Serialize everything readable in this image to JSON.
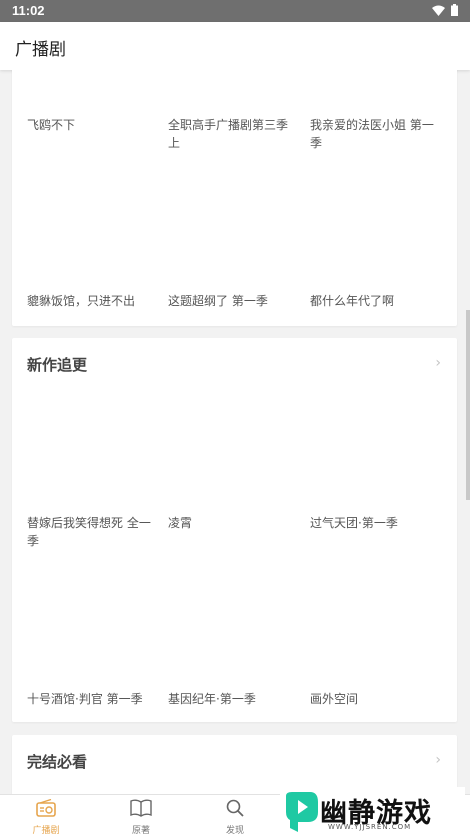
{
  "status_bar": {
    "time": "11:02"
  },
  "app_bar": {
    "title": "广播剧"
  },
  "section_top": {
    "row1": [
      {
        "title": "飞鸥不下"
      },
      {
        "title": "全职高手广播剧第三季上"
      },
      {
        "title": "我亲爱的法医小姐 第一季"
      }
    ],
    "row2": [
      {
        "title": "貔貅饭馆，只进不出"
      },
      {
        "title": "这题超纲了 第一季"
      },
      {
        "title": "都什么年代了啊"
      }
    ]
  },
  "section_new": {
    "title": "新作追更",
    "chevron": "›",
    "row1": [
      {
        "title": "替嫁后我笑得想死 全一季"
      },
      {
        "title": "凌霄"
      },
      {
        "title": "过气天团·第一季"
      }
    ],
    "row2": [
      {
        "title": "十号酒馆·判官 第一季"
      },
      {
        "title": "基因纪年·第一季"
      },
      {
        "title": "画外空间"
      }
    ]
  },
  "section_finished": {
    "title": "完结必看",
    "chevron": "›"
  },
  "bottom_nav": {
    "items": [
      {
        "label": "广播剧",
        "icon": "radio-icon",
        "active": true
      },
      {
        "label": "原著",
        "icon": "book-icon",
        "active": false
      },
      {
        "label": "发现",
        "icon": "search-icon",
        "active": false
      }
    ]
  },
  "watermark": {
    "text": "幽静游戏",
    "url": "WWW.YJJSREN.COM"
  },
  "colors": {
    "accent": "#e6a54e",
    "status_bar": "#6f6f6f",
    "logo": "#1fc9a3"
  }
}
